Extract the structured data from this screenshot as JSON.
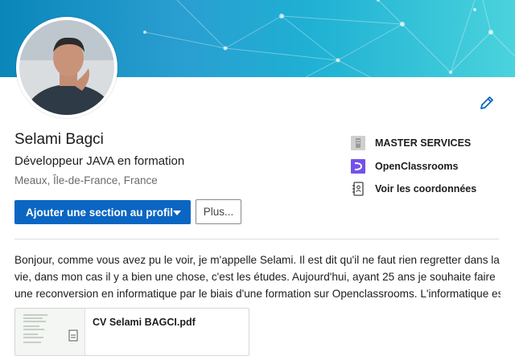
{
  "profile": {
    "name": "Selami Bagci",
    "headline": "Développeur JAVA en formation",
    "location": "Meaux, Île-de-France, France"
  },
  "actions": {
    "primary_label": "Ajouter une section au profil",
    "secondary_label": "Plus..."
  },
  "side_info": {
    "company": "MASTER SERVICES",
    "school": "OpenClassrooms",
    "contact": "Voir les coordonnées"
  },
  "about": {
    "lines": [
      "Bonjour, comme vous avez pu le voir, je m'appelle Selami. Il est dit qu'il ne faut rien regretter dans la",
      "vie, dans mon cas il y a bien une chose, c'est les études. Aujourd'hui, ayant 25 ans je souhaite faire",
      "une reconversion en informatique par le biais d'une formation sur Openclassrooms. L'informatique es..."
    ]
  },
  "document": {
    "title": "CV Selami BAGCI.pdf"
  },
  "icons": {
    "edit": "pencil-icon",
    "company": "building-icon",
    "school": "openclassrooms-logo-icon",
    "contact": "address-book-icon",
    "dropdown": "caret-down-icon",
    "file": "document-icon"
  },
  "colors": {
    "primary": "#0a66c2",
    "openclassrooms": "#7451eb",
    "banner_start": "#0a86b8",
    "banner_end": "#4ad3dd"
  }
}
